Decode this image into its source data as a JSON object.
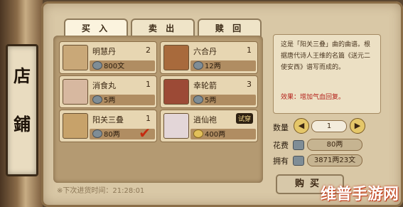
{
  "sign": {
    "char1": "店",
    "char2": "鋪"
  },
  "tabs": [
    "买 入",
    "卖 出",
    "赎 回"
  ],
  "items": [
    {
      "name": "明慧丹",
      "qty": "2",
      "price": "800文",
      "icon": "box-icon"
    },
    {
      "name": "六合丹",
      "qty": "1",
      "price": "12两",
      "icon": "gourd-icon"
    },
    {
      "name": "消食丸",
      "qty": "1",
      "price": "5两",
      "icon": "pill-bottle-icon"
    },
    {
      "name": "幸轮箭",
      "qty": "3",
      "price": "5两",
      "icon": "arrows-icon"
    },
    {
      "name": "阳关三叠",
      "qty": "1",
      "price": "80两",
      "icon": "book-icon"
    },
    {
      "name": "逍仙袍",
      "qty": "",
      "price": "400两",
      "icon": "robe-icon",
      "badge": "试穿"
    }
  ],
  "description": {
    "text": "这是「阳关三叠」曲的曲谱。根据唐代诗人王维的名篇《送元二使安西》谱写而成的。",
    "effect": "效果：增加气血回复。"
  },
  "purchase": {
    "qty_label": "数量",
    "qty_value": "1",
    "cost_label": "花费",
    "cost_value": "80两",
    "own_label": "拥有",
    "own_value": "3871两23文",
    "buy_label": "购买"
  },
  "footer": "※下次进货时间：21:28:01",
  "watermark": "维普手游网"
}
